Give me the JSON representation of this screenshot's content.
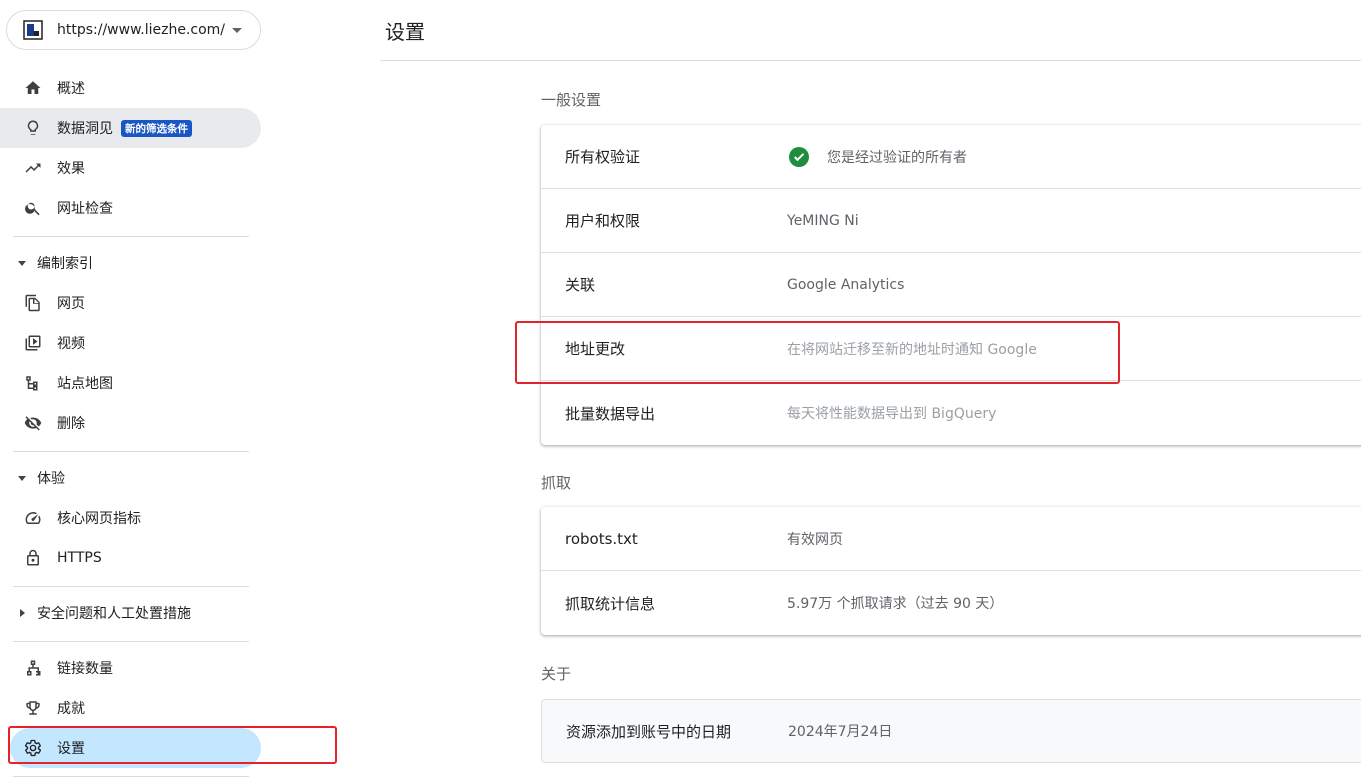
{
  "property": {
    "url": "https://www.liezhe.com/"
  },
  "sidebar": {
    "overview": "概述",
    "insights": "数据洞见",
    "insights_badge": "新的筛选条件",
    "performance": "效果",
    "url_inspection": "网址检查",
    "indexing_section": "编制索引",
    "pages": "网页",
    "videos": "视频",
    "sitemaps": "站点地图",
    "removals": "删除",
    "experience_section": "体验",
    "core_web_vitals": "核心网页指标",
    "https": "HTTPS",
    "security_section": "安全问题和人工处置措施",
    "links": "链接数量",
    "achievements": "成就",
    "settings": "设置"
  },
  "header": {
    "title": "设置"
  },
  "general": {
    "title": "一般设置",
    "rows": [
      {
        "label": "所有权验证",
        "value": "您是经过验证的所有者"
      },
      {
        "label": "用户和权限",
        "value": "YeMING Ni"
      },
      {
        "label": "关联",
        "value": "Google Analytics"
      },
      {
        "label": "地址更改",
        "value": "在将网站迁移至新的地址时通知 Google"
      },
      {
        "label": "批量数据导出",
        "value": "每天将性能数据导出到 BigQuery"
      }
    ]
  },
  "crawl": {
    "title": "抓取",
    "rows": [
      {
        "label": "robots.txt",
        "value": "有效网页"
      },
      {
        "label": "抓取统计信息",
        "value": "5.97万 个抓取请求（过去 90 天）"
      }
    ]
  },
  "about": {
    "title": "关于",
    "rows": [
      {
        "label": "资源添加到账号中的日期",
        "value": "2024年7月24日"
      }
    ]
  },
  "colors": {
    "accent": "#1a73e8",
    "active_bg": "#c2e7ff",
    "check": "#1e8e3e",
    "highlight": "#e3242b"
  }
}
